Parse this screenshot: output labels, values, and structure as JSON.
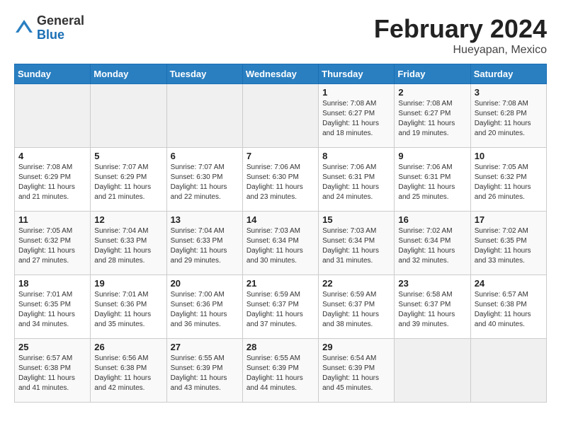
{
  "header": {
    "logo_general": "General",
    "logo_blue": "Blue",
    "month_title": "February 2024",
    "location": "Hueyapan, Mexico"
  },
  "weekdays": [
    "Sunday",
    "Monday",
    "Tuesday",
    "Wednesday",
    "Thursday",
    "Friday",
    "Saturday"
  ],
  "weeks": [
    [
      {
        "day": "",
        "info": ""
      },
      {
        "day": "",
        "info": ""
      },
      {
        "day": "",
        "info": ""
      },
      {
        "day": "",
        "info": ""
      },
      {
        "day": "1",
        "info": "Sunrise: 7:08 AM\nSunset: 6:27 PM\nDaylight: 11 hours\nand 18 minutes."
      },
      {
        "day": "2",
        "info": "Sunrise: 7:08 AM\nSunset: 6:27 PM\nDaylight: 11 hours\nand 19 minutes."
      },
      {
        "day": "3",
        "info": "Sunrise: 7:08 AM\nSunset: 6:28 PM\nDaylight: 11 hours\nand 20 minutes."
      }
    ],
    [
      {
        "day": "4",
        "info": "Sunrise: 7:08 AM\nSunset: 6:29 PM\nDaylight: 11 hours\nand 21 minutes."
      },
      {
        "day": "5",
        "info": "Sunrise: 7:07 AM\nSunset: 6:29 PM\nDaylight: 11 hours\nand 21 minutes."
      },
      {
        "day": "6",
        "info": "Sunrise: 7:07 AM\nSunset: 6:30 PM\nDaylight: 11 hours\nand 22 minutes."
      },
      {
        "day": "7",
        "info": "Sunrise: 7:06 AM\nSunset: 6:30 PM\nDaylight: 11 hours\nand 23 minutes."
      },
      {
        "day": "8",
        "info": "Sunrise: 7:06 AM\nSunset: 6:31 PM\nDaylight: 11 hours\nand 24 minutes."
      },
      {
        "day": "9",
        "info": "Sunrise: 7:06 AM\nSunset: 6:31 PM\nDaylight: 11 hours\nand 25 minutes."
      },
      {
        "day": "10",
        "info": "Sunrise: 7:05 AM\nSunset: 6:32 PM\nDaylight: 11 hours\nand 26 minutes."
      }
    ],
    [
      {
        "day": "11",
        "info": "Sunrise: 7:05 AM\nSunset: 6:32 PM\nDaylight: 11 hours\nand 27 minutes."
      },
      {
        "day": "12",
        "info": "Sunrise: 7:04 AM\nSunset: 6:33 PM\nDaylight: 11 hours\nand 28 minutes."
      },
      {
        "day": "13",
        "info": "Sunrise: 7:04 AM\nSunset: 6:33 PM\nDaylight: 11 hours\nand 29 minutes."
      },
      {
        "day": "14",
        "info": "Sunrise: 7:03 AM\nSunset: 6:34 PM\nDaylight: 11 hours\nand 30 minutes."
      },
      {
        "day": "15",
        "info": "Sunrise: 7:03 AM\nSunset: 6:34 PM\nDaylight: 11 hours\nand 31 minutes."
      },
      {
        "day": "16",
        "info": "Sunrise: 7:02 AM\nSunset: 6:34 PM\nDaylight: 11 hours\nand 32 minutes."
      },
      {
        "day": "17",
        "info": "Sunrise: 7:02 AM\nSunset: 6:35 PM\nDaylight: 11 hours\nand 33 minutes."
      }
    ],
    [
      {
        "day": "18",
        "info": "Sunrise: 7:01 AM\nSunset: 6:35 PM\nDaylight: 11 hours\nand 34 minutes."
      },
      {
        "day": "19",
        "info": "Sunrise: 7:01 AM\nSunset: 6:36 PM\nDaylight: 11 hours\nand 35 minutes."
      },
      {
        "day": "20",
        "info": "Sunrise: 7:00 AM\nSunset: 6:36 PM\nDaylight: 11 hours\nand 36 minutes."
      },
      {
        "day": "21",
        "info": "Sunrise: 6:59 AM\nSunset: 6:37 PM\nDaylight: 11 hours\nand 37 minutes."
      },
      {
        "day": "22",
        "info": "Sunrise: 6:59 AM\nSunset: 6:37 PM\nDaylight: 11 hours\nand 38 minutes."
      },
      {
        "day": "23",
        "info": "Sunrise: 6:58 AM\nSunset: 6:37 PM\nDaylight: 11 hours\nand 39 minutes."
      },
      {
        "day": "24",
        "info": "Sunrise: 6:57 AM\nSunset: 6:38 PM\nDaylight: 11 hours\nand 40 minutes."
      }
    ],
    [
      {
        "day": "25",
        "info": "Sunrise: 6:57 AM\nSunset: 6:38 PM\nDaylight: 11 hours\nand 41 minutes."
      },
      {
        "day": "26",
        "info": "Sunrise: 6:56 AM\nSunset: 6:38 PM\nDaylight: 11 hours\nand 42 minutes."
      },
      {
        "day": "27",
        "info": "Sunrise: 6:55 AM\nSunset: 6:39 PM\nDaylight: 11 hours\nand 43 minutes."
      },
      {
        "day": "28",
        "info": "Sunrise: 6:55 AM\nSunset: 6:39 PM\nDaylight: 11 hours\nand 44 minutes."
      },
      {
        "day": "29",
        "info": "Sunrise: 6:54 AM\nSunset: 6:39 PM\nDaylight: 11 hours\nand 45 minutes."
      },
      {
        "day": "",
        "info": ""
      },
      {
        "day": "",
        "info": ""
      }
    ]
  ]
}
